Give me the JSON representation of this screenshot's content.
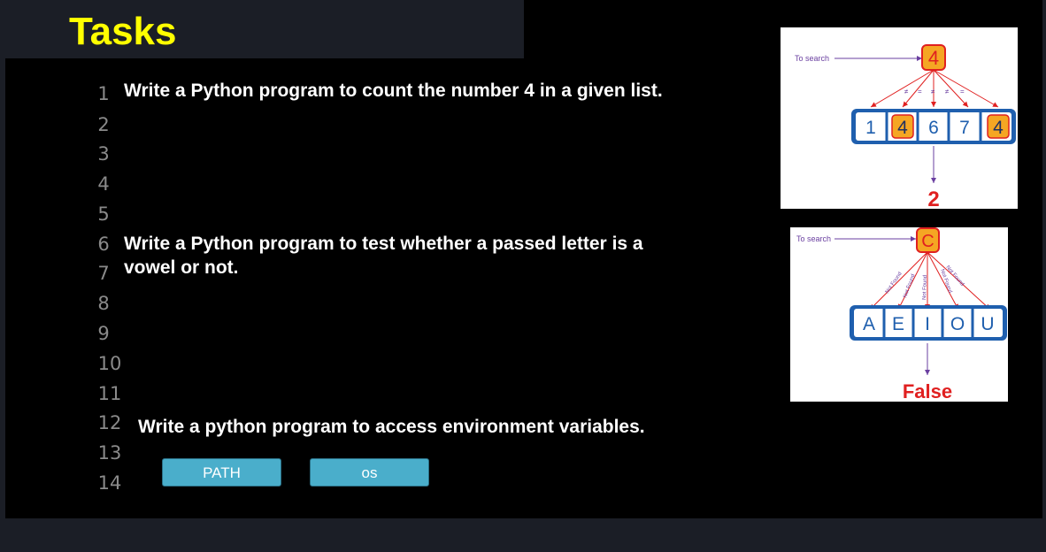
{
  "header": {
    "title": "Tasks"
  },
  "line_numbers": [
    "1",
    "2",
    "3",
    "4",
    "5",
    "6",
    "7",
    "8",
    "9",
    "10",
    "11",
    "12",
    "13",
    "14"
  ],
  "tasks": {
    "task1": "Write a Python program to count the number 4 in a given list.",
    "task2_line1": "Write a Python program to test whether a passed letter is a",
    "task2_line2": "vowel or not.",
    "task3": "Write a python program to access environment variables."
  },
  "buttons": {
    "path": "PATH",
    "os": "os"
  },
  "figure_count": {
    "to_search_label": "To search",
    "target": "4",
    "comparisons": [
      "≠",
      "=",
      "≠",
      "≠",
      "="
    ],
    "list": [
      "1",
      "4",
      "6",
      "7",
      "4"
    ],
    "result": "2"
  },
  "figure_vowel": {
    "to_search_label": "To search",
    "target": "C",
    "edge_labels": [
      "Not Found",
      "Not Found",
      "Not Found",
      "Not Found",
      "Not Found"
    ],
    "list": [
      "A",
      "E",
      "I",
      "O",
      "U"
    ],
    "result": "False"
  },
  "colors": {
    "title": "#ffff00",
    "button": "#4aaecb",
    "accent_orange": "#f5a623",
    "accent_red": "#e02020",
    "list_blue": "#1f5fae"
  }
}
